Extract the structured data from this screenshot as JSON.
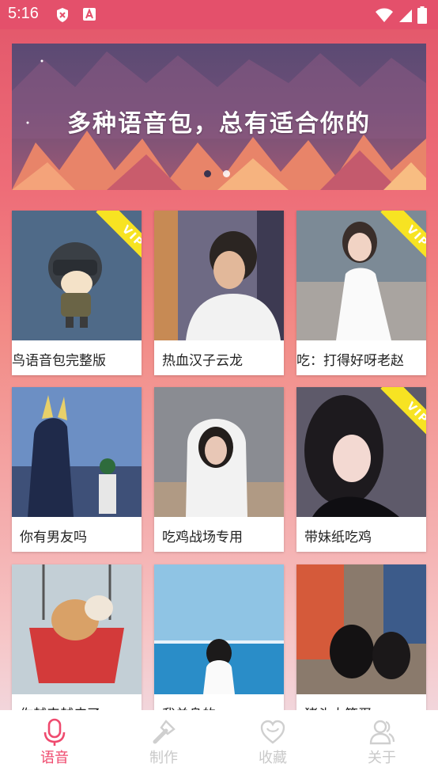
{
  "status_bar": {
    "time": "5:16"
  },
  "banner": {
    "text": "多种语音包，总有适合你的",
    "page_count": 2,
    "active_page": 2
  },
  "voice_packs": [
    {
      "title": "鸟语音包完整版",
      "vip": true
    },
    {
      "title": "热血汉子云龙",
      "vip": false
    },
    {
      "title": "吃：打得好呀老赵",
      "vip": true
    },
    {
      "title": "你有男友吗",
      "vip": false
    },
    {
      "title": "吃鸡战场专用",
      "vip": false
    },
    {
      "title": "带妹纸吃鸡",
      "vip": true
    },
    {
      "title": "你越来越皮了",
      "vip": false
    },
    {
      "title": "我单身的",
      "vip": false
    },
    {
      "title": "猪头大笨蛋",
      "vip": false
    }
  ],
  "vip_badge": "VIP",
  "tabs": [
    {
      "label": "语音",
      "icon": "microphone-icon",
      "active": true
    },
    {
      "label": "制作",
      "icon": "magic-wand-icon",
      "active": false
    },
    {
      "label": "收藏",
      "icon": "heart-icon",
      "active": false
    },
    {
      "label": "关于",
      "icon": "user-group-icon",
      "active": false
    }
  ],
  "colors": {
    "accent": "#ef4a6e",
    "status_bar": "#e4506b",
    "vip": "#f7e322",
    "inactive_tab": "#c9c9c9"
  }
}
